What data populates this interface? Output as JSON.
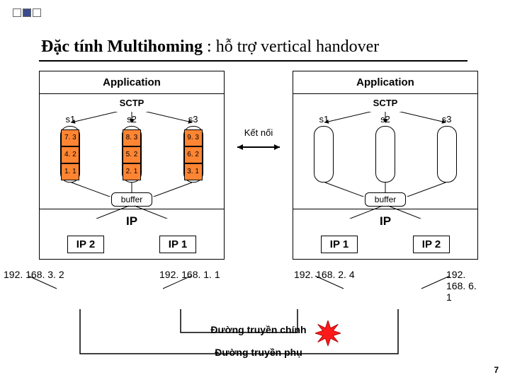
{
  "title": {
    "bold": "Đặc tính Multihoming",
    "rest": " : hỗ trợ vertical handover"
  },
  "left": {
    "application": "Application",
    "sctp": "SCTP",
    "streams": [
      {
        "label": "s1",
        "cells": [
          "7. 3",
          "4. 2",
          "1. 1"
        ]
      },
      {
        "label": "s2",
        "cells": [
          "8. 3",
          "5. 2",
          "2. 1"
        ]
      },
      {
        "label": "s3",
        "cells": [
          "9. 3",
          "6. 2",
          "3. 1"
        ]
      }
    ],
    "buffer": "buffer",
    "ip": "IP",
    "ip_subs": [
      "IP 2",
      "IP 1"
    ],
    "ip_addrs": [
      "192. 168. 3. 2",
      "192. 168. 1. 1"
    ]
  },
  "right": {
    "application": "Application",
    "sctp": "SCTP",
    "streams": [
      {
        "label": "s1"
      },
      {
        "label": "s2"
      },
      {
        "label": "s3"
      }
    ],
    "buffer": "buffer",
    "ip": "IP",
    "ip_subs": [
      "IP 1",
      "IP 2"
    ],
    "ip_addrs": [
      "192. 168. 2. 4",
      "192. 168. 6. 1"
    ]
  },
  "connect_label": "Kết nối",
  "path_main": "Đường truyền chính",
  "path_backup": "Đường truyền phụ",
  "page": "7"
}
